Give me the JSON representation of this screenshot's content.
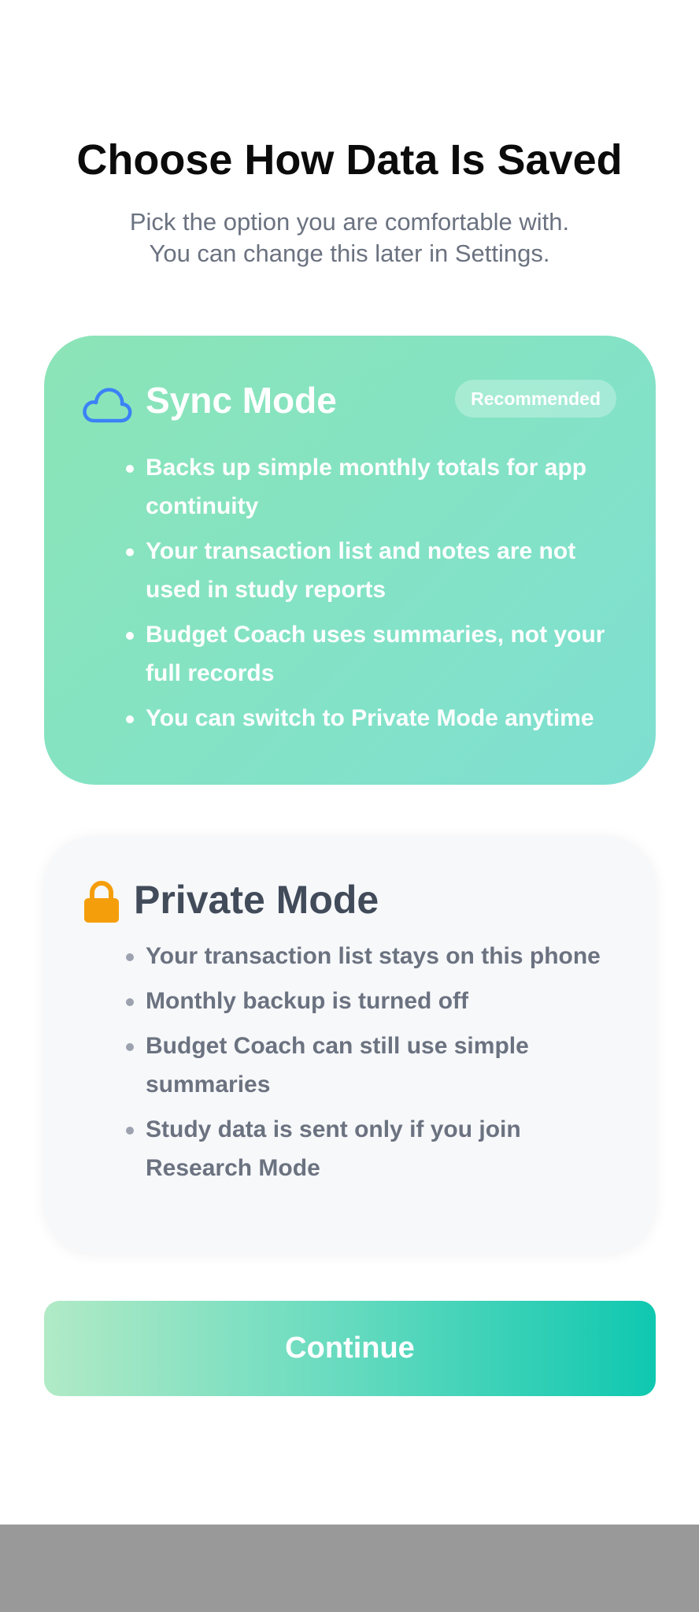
{
  "header": {
    "title": "Choose How Data Is Saved",
    "subtitle_line1": "Pick the option you are comfortable with.",
    "subtitle_line2": "You can change this later in Settings."
  },
  "sync_mode": {
    "icon": "cloud-icon",
    "title": "Sync Mode",
    "badge": "Recommended",
    "bullets": [
      "Backs up simple monthly totals for app continuity",
      "Your transaction list and notes are not used in study reports",
      "Budget Coach uses summaries, not your full records",
      "You can switch to Private Mode anytime"
    ],
    "colors": {
      "gradient_start": "#8ce4b7",
      "gradient_end": "#7edfd2",
      "icon": "#3b82f6"
    }
  },
  "private_mode": {
    "icon": "lock-icon",
    "title": "Private Mode",
    "bullets": [
      "Your transaction list stays on this phone",
      "Monthly backup is turned off",
      "Budget Coach can still use simple summaries",
      "Study data is sent only if you join Research Mode"
    ],
    "colors": {
      "background": "#f7f8fa",
      "icon": "#f59e0b",
      "title": "#414b5a"
    }
  },
  "actions": {
    "continue_label": "Continue"
  },
  "colors": {
    "accent_end": "#0fc8b0",
    "accent_start": "#b1eac6",
    "bottom_bar": "#999999"
  }
}
